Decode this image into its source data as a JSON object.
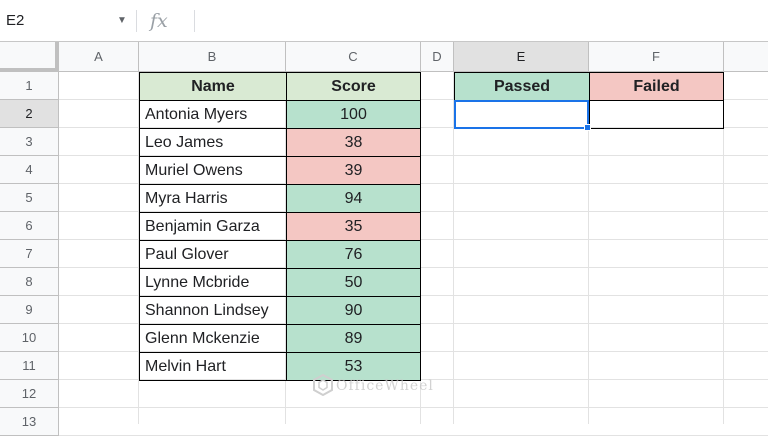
{
  "formula_bar": {
    "name_box": "E2",
    "fx_symbol": "fx",
    "formula": ""
  },
  "columns": [
    "A",
    "B",
    "C",
    "D",
    "E",
    "F"
  ],
  "rows": [
    "1",
    "2",
    "3",
    "4",
    "5",
    "6",
    "7",
    "8",
    "9",
    "10",
    "11",
    "12",
    "13"
  ],
  "selected_cell": "E2",
  "table": {
    "header_name": "Name",
    "header_score": "Score",
    "rows": [
      {
        "name": "Antonia Myers",
        "score": "100",
        "status": "pass"
      },
      {
        "name": "Leo James",
        "score": "38",
        "status": "fail"
      },
      {
        "name": "Muriel Owens",
        "score": "39",
        "status": "fail"
      },
      {
        "name": "Myra Harris",
        "score": "94",
        "status": "pass"
      },
      {
        "name": "Benjamin Garza",
        "score": "35",
        "status": "fail"
      },
      {
        "name": "Paul Glover",
        "score": "76",
        "status": "pass"
      },
      {
        "name": "Lynne Mcbride",
        "score": "50",
        "status": "pass"
      },
      {
        "name": "Shannon Lindsey",
        "score": "90",
        "status": "pass"
      },
      {
        "name": "Glenn Mckenzie",
        "score": "89",
        "status": "pass"
      },
      {
        "name": "Melvin Hart",
        "score": "53",
        "status": "pass"
      }
    ]
  },
  "summary": {
    "passed_label": "Passed",
    "failed_label": "Failed",
    "passed_value": "",
    "failed_value": ""
  },
  "watermark": "OfficeWheel",
  "colors": {
    "pass": "#b7e1cd",
    "fail": "#f4c7c3",
    "header_green": "#d9ead3",
    "selection": "#1a73e8"
  }
}
